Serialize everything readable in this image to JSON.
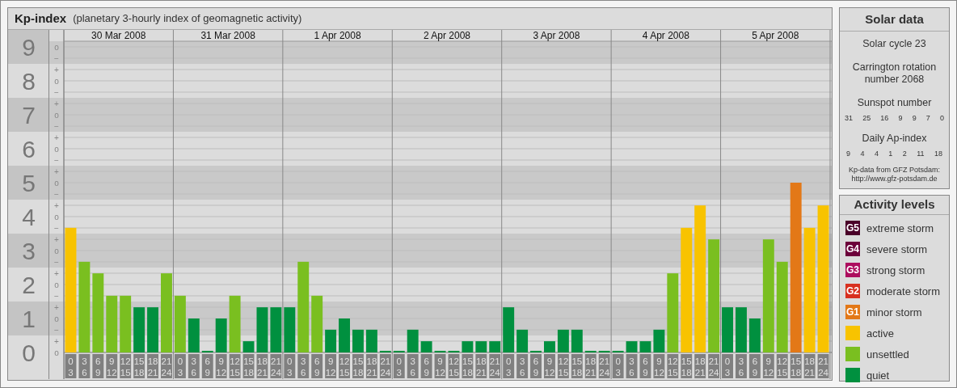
{
  "chart_panel": {
    "title": "Kp-index",
    "subtitle": "(planetary 3-hourly index of geomagnetic activity)",
    "days": [
      {
        "date": "30 Mar 2008",
        "slots": [
          {
            "from": "0",
            "to": "3"
          },
          {
            "from": "3",
            "to": "6"
          },
          {
            "from": "6",
            "to": "9"
          },
          {
            "from": "9",
            "to": "12"
          },
          {
            "from": "12",
            "to": "15"
          },
          {
            "from": "15",
            "to": "18"
          },
          {
            "from": "18",
            "to": "21"
          },
          {
            "from": "21",
            "to": "24"
          }
        ]
      },
      {
        "date": "31 Mar 2008",
        "slots": [
          {
            "from": "0",
            "to": "3"
          },
          {
            "from": "3",
            "to": "6"
          },
          {
            "from": "6",
            "to": "9"
          },
          {
            "from": "9",
            "to": "12"
          },
          {
            "from": "12",
            "to": "15"
          },
          {
            "from": "15",
            "to": "18"
          },
          {
            "from": "18",
            "to": "21"
          },
          {
            "from": "21",
            "to": "24"
          }
        ]
      },
      {
        "date": "1 Apr 2008",
        "slots": [
          {
            "from": "0",
            "to": "3"
          },
          {
            "from": "3",
            "to": "6"
          },
          {
            "from": "6",
            "to": "9"
          },
          {
            "from": "9",
            "to": "12"
          },
          {
            "from": "12",
            "to": "15"
          },
          {
            "from": "15",
            "to": "18"
          },
          {
            "from": "18",
            "to": "21"
          },
          {
            "from": "21",
            "to": "24"
          }
        ]
      },
      {
        "date": "2 Apr 2008",
        "slots": [
          {
            "from": "0",
            "to": "3"
          },
          {
            "from": "3",
            "to": "6"
          },
          {
            "from": "6",
            "to": "9"
          },
          {
            "from": "9",
            "to": "12"
          },
          {
            "from": "12",
            "to": "15"
          },
          {
            "from": "15",
            "to": "18"
          },
          {
            "from": "18",
            "to": "21"
          },
          {
            "from": "21",
            "to": "24"
          }
        ]
      },
      {
        "date": "3 Apr 2008",
        "slots": [
          {
            "from": "0",
            "to": "3"
          },
          {
            "from": "3",
            "to": "6"
          },
          {
            "from": "6",
            "to": "9"
          },
          {
            "from": "9",
            "to": "12"
          },
          {
            "from": "12",
            "to": "15"
          },
          {
            "from": "15",
            "to": "18"
          },
          {
            "from": "18",
            "to": "21"
          },
          {
            "from": "21",
            "to": "24"
          }
        ]
      },
      {
        "date": "4 Apr 2008",
        "slots": [
          {
            "from": "0",
            "to": "3"
          },
          {
            "from": "3",
            "to": "6"
          },
          {
            "from": "6",
            "to": "9"
          },
          {
            "from": "9",
            "to": "12"
          },
          {
            "from": "12",
            "to": "15"
          },
          {
            "from": "15",
            "to": "18"
          },
          {
            "from": "18",
            "to": "21"
          },
          {
            "from": "21",
            "to": "24"
          }
        ]
      },
      {
        "date": "5 Apr 2008",
        "slots": [
          {
            "from": "0",
            "to": "3"
          },
          {
            "from": "3",
            "to": "6"
          },
          {
            "from": "6",
            "to": "9"
          },
          {
            "from": "9",
            "to": "12"
          },
          {
            "from": "12",
            "to": "15"
          },
          {
            "from": "15",
            "to": "18"
          },
          {
            "from": "18",
            "to": "21"
          },
          {
            "from": "21",
            "to": "24"
          }
        ]
      }
    ],
    "minor_ticks": [
      "o",
      "−",
      "+",
      "o",
      "−",
      "+",
      "o",
      "−",
      "+",
      "o",
      "−",
      "+",
      "o",
      "−",
      "+",
      "o",
      "−",
      "+",
      "o",
      "−",
      "+",
      "o",
      "−",
      "+",
      "o",
      "−",
      "+",
      "o"
    ],
    "chart_data": {
      "type": "bar",
      "grid": true,
      "ylim": [
        0,
        9
      ],
      "yticks": [
        {
          "value": 9,
          "label": "9"
        },
        {
          "value": 8,
          "label": "8"
        },
        {
          "value": 7,
          "label": "7"
        },
        {
          "value": 6,
          "label": "6"
        },
        {
          "value": 5,
          "label": "5"
        },
        {
          "value": 4,
          "label": "4"
        },
        {
          "value": 3,
          "label": "3"
        },
        {
          "value": 2,
          "label": "2"
        },
        {
          "value": 1,
          "label": "1"
        },
        {
          "value": 0,
          "label": "0"
        }
      ],
      "values": [
        3.67,
        2.67,
        2.33,
        1.67,
        1.67,
        1.33,
        1.33,
        2.33,
        1.67,
        1,
        0,
        1,
        1.67,
        0.33,
        1.33,
        1.33,
        1.33,
        2.67,
        1.67,
        0.67,
        1,
        0.67,
        0.67,
        0,
        0,
        0.67,
        0.33,
        0,
        0,
        0.33,
        0.33,
        0.33,
        1.33,
        0.67,
        0,
        0.33,
        0.67,
        0.67,
        0,
        0,
        0,
        0.33,
        0.33,
        0.67,
        2.33,
        3.67,
        4.33,
        3.33,
        1.33,
        1.33,
        1,
        3.33,
        2.67,
        5,
        3.67,
        4.33
      ]
    }
  },
  "solar_data": {
    "title": "Solar data",
    "solar_cycle": "Solar cycle 23",
    "carrington": "Carrington rotation number 2068",
    "sunspot_label": "Sunspot number",
    "sunspot_numbers": [
      "31",
      "25",
      "16",
      "9",
      "9",
      "7",
      "0"
    ],
    "ap_label": "Daily Ap-index",
    "ap_values": [
      "9",
      "4",
      "4",
      "1",
      "2",
      "11",
      "18"
    ],
    "credit_lines": [
      "Kp-data from GFZ Potsdam:",
      "http://www.gfz-potsdam.de"
    ]
  },
  "activity_levels": {
    "title": "Activity levels",
    "items": [
      {
        "badge": "G5",
        "label": "extreme storm",
        "color": "#4a0028"
      },
      {
        "badge": "G4",
        "label": "severe storm",
        "color": "#6c003a"
      },
      {
        "badge": "G3",
        "label": "strong storm",
        "color": "#ad0d5e"
      },
      {
        "badge": "G2",
        "label": "moderate storm",
        "color": "#d8301f"
      },
      {
        "badge": "G1",
        "label": "minor storm",
        "color": "#e37817"
      },
      {
        "label": "active",
        "color": "#f8c300"
      },
      {
        "label": "unsettled",
        "color": "#7abf20"
      },
      {
        "label": "quiet",
        "color": "#00903f"
      }
    ]
  }
}
